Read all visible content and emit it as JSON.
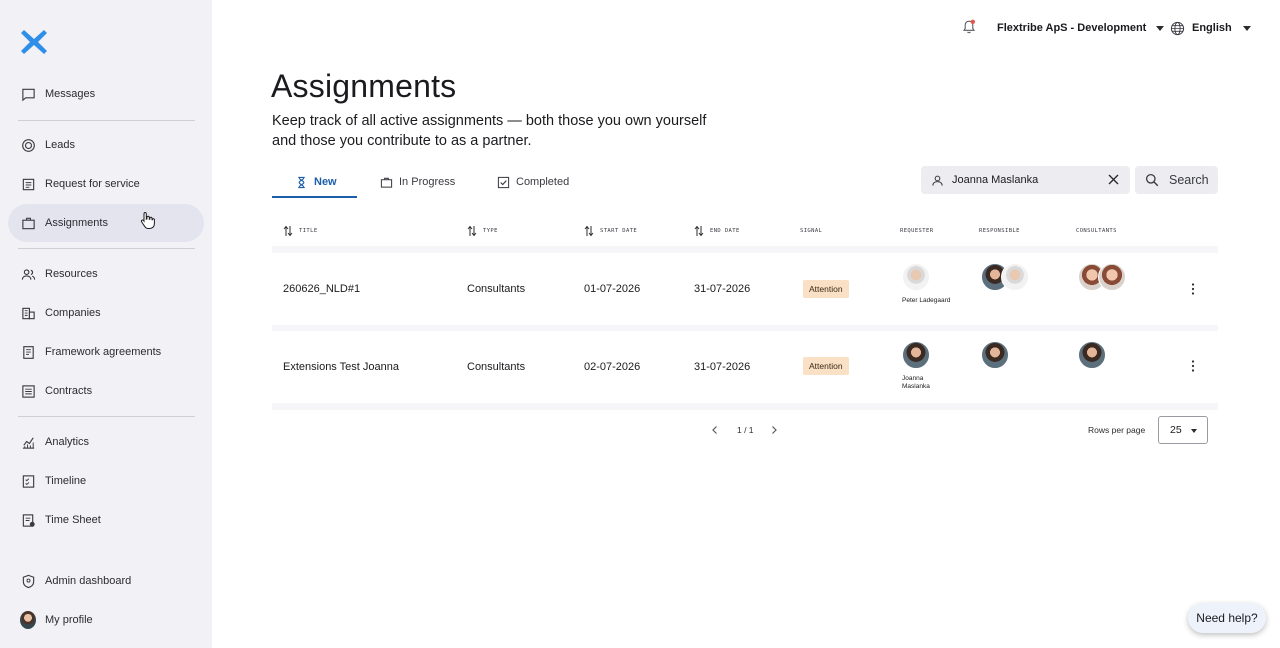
{
  "sidebar": {
    "items": [
      {
        "label": "Messages",
        "icon": "message-icon"
      },
      {
        "label": "Leads",
        "icon": "target-icon"
      },
      {
        "label": "Request for service",
        "icon": "request-icon"
      },
      {
        "label": "Assignments",
        "icon": "briefcase-icon",
        "active": true
      },
      {
        "label": "Resources",
        "icon": "people-icon"
      },
      {
        "label": "Companies",
        "icon": "building-icon"
      },
      {
        "label": "Framework agreements",
        "icon": "document-icon"
      },
      {
        "label": "Contracts",
        "icon": "list-icon"
      },
      {
        "label": "Analytics",
        "icon": "chart-icon"
      },
      {
        "label": "Timeline",
        "icon": "timeline-icon"
      },
      {
        "label": "Time Sheet",
        "icon": "timesheet-icon"
      },
      {
        "label": "Admin dashboard",
        "icon": "shield-icon"
      },
      {
        "label": "My profile",
        "icon": "avatar"
      }
    ]
  },
  "topbar": {
    "organization": "Flextribe ApS - Development",
    "language": "English"
  },
  "header": {
    "title": "Assignments",
    "subtitle": "Keep track of all active assignments — both those you own yourself and those you contribute to as a partner."
  },
  "tabs": [
    {
      "label": "New",
      "icon": "hourglass-icon",
      "active": true
    },
    {
      "label": "In Progress",
      "icon": "briefcase-icon"
    },
    {
      "label": "Completed",
      "icon": "checkbox-icon"
    }
  ],
  "search": {
    "value": "Joanna Maslanka",
    "button_label": "Search"
  },
  "table": {
    "columns": [
      "Title",
      "Type",
      "Start date",
      "End date",
      "Signal",
      "Requester",
      "Responsible",
      "Consultants"
    ],
    "rows": [
      {
        "title": "260626_NLD#1",
        "type": "Consultants",
        "start_date": "01-07-2026",
        "end_date": "31-07-2026",
        "signal": "Attention",
        "requester": "Peter Ladegaard"
      },
      {
        "title": "Extensions Test Joanna",
        "type": "Consultants",
        "start_date": "02-07-2026",
        "end_date": "31-07-2026",
        "signal": "Attention",
        "requester_line1": "Joanna",
        "requester_line2": "Maslanka"
      }
    ]
  },
  "pagination": {
    "page_text": "1 / 1",
    "rows_per_page_label": "Rows per page",
    "rows_per_page": "25"
  },
  "help": {
    "label": "Need help?"
  },
  "colors": {
    "accent": "#1d5ea8",
    "sidebar_bg": "#f1f1f6",
    "badge_bg": "#fae0c4",
    "logo": "#2f8fe8"
  }
}
